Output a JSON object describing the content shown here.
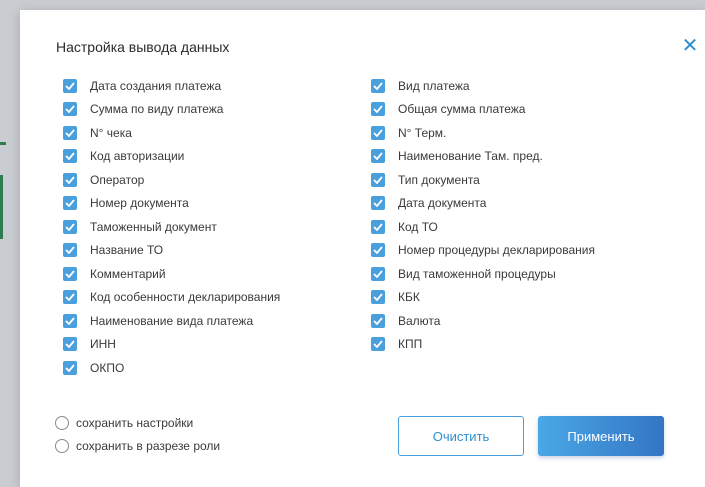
{
  "dialog": {
    "title": "Настройка вывода данных",
    "close_icon": "close-icon",
    "accent_color": "#4a9fdd"
  },
  "left_column": [
    {
      "label": "Дата создания платежа",
      "checked": true
    },
    {
      "label": "Сумма по виду платежа",
      "checked": true
    },
    {
      "label": "N° чека",
      "checked": true
    },
    {
      "label": "Код авторизации",
      "checked": true
    },
    {
      "label": "Оператор",
      "checked": true
    },
    {
      "label": "Номер документа",
      "checked": true
    },
    {
      "label": "Таможенный документ",
      "checked": true
    },
    {
      "label": "Название ТО",
      "checked": true
    },
    {
      "label": "Комментарий",
      "checked": true
    },
    {
      "label": "Код особенности декларирования",
      "checked": true
    },
    {
      "label": "Наименование вида платежа",
      "checked": true
    },
    {
      "label": "ИНН",
      "checked": true
    },
    {
      "label": "ОКПО",
      "checked": true
    }
  ],
  "right_column": [
    {
      "label": "Вид платежа",
      "checked": true
    },
    {
      "label": "Общая сумма платежа",
      "checked": true
    },
    {
      "label": "N° Терм.",
      "checked": true
    },
    {
      "label": "Наименование Там. пред.",
      "checked": true
    },
    {
      "label": "Тип документа",
      "checked": true
    },
    {
      "label": "Дата документа",
      "checked": true
    },
    {
      "label": "Код ТО",
      "checked": true
    },
    {
      "label": "Номер процедуры декларирования",
      "checked": true
    },
    {
      "label": "Вид таможенной процедуры",
      "checked": true
    },
    {
      "label": "КБК",
      "checked": true
    },
    {
      "label": "Валюта",
      "checked": true
    },
    {
      "label": "КПП",
      "checked": true
    }
  ],
  "options": {
    "save_settings": {
      "label": "сохранить настройки",
      "selected": false
    },
    "save_by_role": {
      "label": "сохранить в разрезе роли",
      "selected": false
    }
  },
  "buttons": {
    "clear_label": "Очистить",
    "apply_label": "Применить"
  }
}
